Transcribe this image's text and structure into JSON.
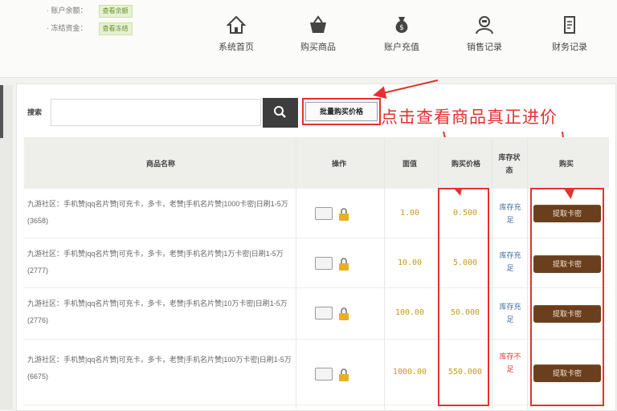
{
  "account": {
    "balance_label": "· 账户余额：",
    "balance_value": "查看余额",
    "deposit_label": "· 冻结资金：",
    "deposit_value": "查看冻结"
  },
  "nav": [
    {
      "label": "系统首页",
      "icon": "home-icon"
    },
    {
      "label": "购买商品",
      "icon": "basket-icon"
    },
    {
      "label": "账户充值",
      "icon": "money-bag-icon"
    },
    {
      "label": "销售记录",
      "icon": "user-record-icon"
    },
    {
      "label": "财务记录",
      "icon": "document-icon"
    }
  ],
  "search": {
    "label": "搜索",
    "placeholder": "",
    "batch_button": "批量购买价格"
  },
  "annotation": "点击查看商品真正进价",
  "table": {
    "headers": {
      "name": "商品名称",
      "ops": "操作",
      "face": "面值",
      "price": "购买价格",
      "stock": "库存状态",
      "buy": "购买"
    },
    "rows": [
      {
        "name": "九游社区：手机赞|qq名片赞|可充卡，多卡，老赞|手机名片赞|1000卡密|日刷1-5万(3658)",
        "face": "1.00",
        "price": "0.500",
        "stock": "库存充足",
        "buy": "提取卡密"
      },
      {
        "name": "九游社区：手机赞|qq名片赞|可充卡，多卡，老赞|手机名片赞|1万卡密|日刷1-5万(2777)",
        "face": "10.00",
        "price": "5.000",
        "stock": "库存充足",
        "buy": "提取卡密"
      },
      {
        "name": "九游社区：手机赞|qq名片赞|可充卡，多卡，老赞|手机名片赞|10万卡密|日刷1-5万(2776)",
        "face": "100.00",
        "price": "50.000",
        "stock": "库存充足",
        "buy": "提取卡密"
      },
      {
        "name": "九游社区：手机赞|qq名片赞|可充卡，多卡，老赞|手机名片赞|100万卡密|日刷1-5万(6675)",
        "face": "1000.00",
        "price": "550.000",
        "stock": "库存不足",
        "buy": "提取卡密"
      }
    ]
  },
  "colors": {
    "annotation": "#e53030",
    "buy_button": "#6a3f1e",
    "price": "#c79a1a",
    "stock_ok": "#3b6ea5"
  }
}
